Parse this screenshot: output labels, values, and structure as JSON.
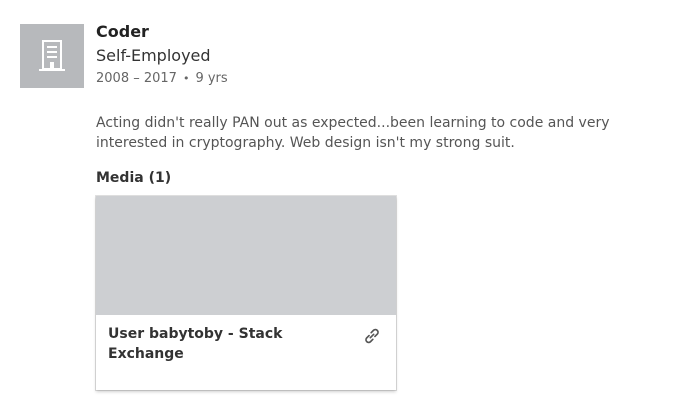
{
  "experience": {
    "title": "Coder",
    "company": "Self-Employed",
    "date_range": "2008 – 2017",
    "separator": "•",
    "duration": "9 yrs",
    "description": "Acting didn't really PAN out as expected...been learning to code and very interested in cryptography. Web design isn't my strong suit.",
    "logo_icon": "building-icon"
  },
  "media": {
    "heading": "Media (1)",
    "items": [
      {
        "caption": "User babytoby - Stack Exchange",
        "icon": "link-icon"
      }
    ]
  },
  "colors": {
    "logo_bg": "#b7b9bc",
    "thumb_bg": "#cdcfd2"
  }
}
